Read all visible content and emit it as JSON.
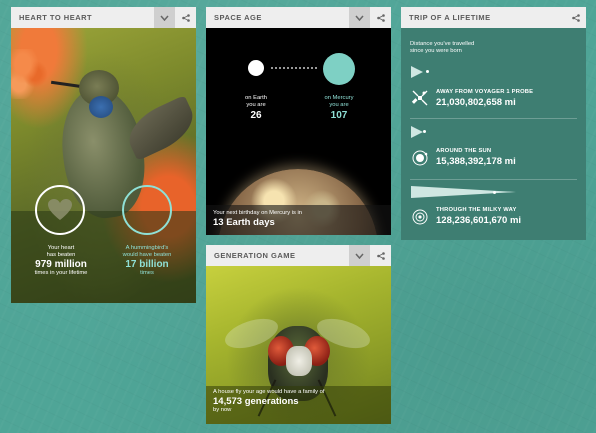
{
  "cards": {
    "heart": {
      "title": "HEART TO HEART",
      "stat_human": {
        "line1": "Your heart",
        "line2": "has beaten",
        "value": "979 million",
        "line3": "times in your lifetime"
      },
      "stat_bird": {
        "line1": "A hummingbird's",
        "line2": "would have beaten",
        "value": "17 billion",
        "line3": "times"
      }
    },
    "space": {
      "title": "SPACE AGE",
      "earth": {
        "label1": "on Earth",
        "label2": "you are",
        "value": "26"
      },
      "mercury": {
        "label1": "on Mercury",
        "label2": "you are",
        "value": "107"
      },
      "caption": "Your next birthday on Mercury is in",
      "caption_value": "13 Earth days"
    },
    "generation": {
      "title": "GENERATION GAME",
      "caption": "A house fly your age would have a family of",
      "caption_value": "14,573 generations",
      "caption_tail": "by now"
    },
    "trip": {
      "title": "TRIP OF A LIFETIME",
      "intro1": "Distance you've travelled",
      "intro2": "since you were born",
      "rows": [
        {
          "label": "AWAY FROM VOYAGER 1 PROBE",
          "value": "21,030,802,658 mi",
          "icon": "satellite-icon"
        },
        {
          "label": "AROUND THE SUN",
          "value": "15,388,392,178 mi",
          "icon": "sun-orbit-icon"
        },
        {
          "label": "THROUGH THE MILKY WAY",
          "value": "128,236,601,670 mi",
          "icon": "galaxy-icon"
        }
      ]
    }
  },
  "colors": {
    "background": "#4fa597",
    "header": "#eeeeee",
    "accent_teal": "#8fe0d6",
    "trip_panel": "#3e7e72"
  }
}
